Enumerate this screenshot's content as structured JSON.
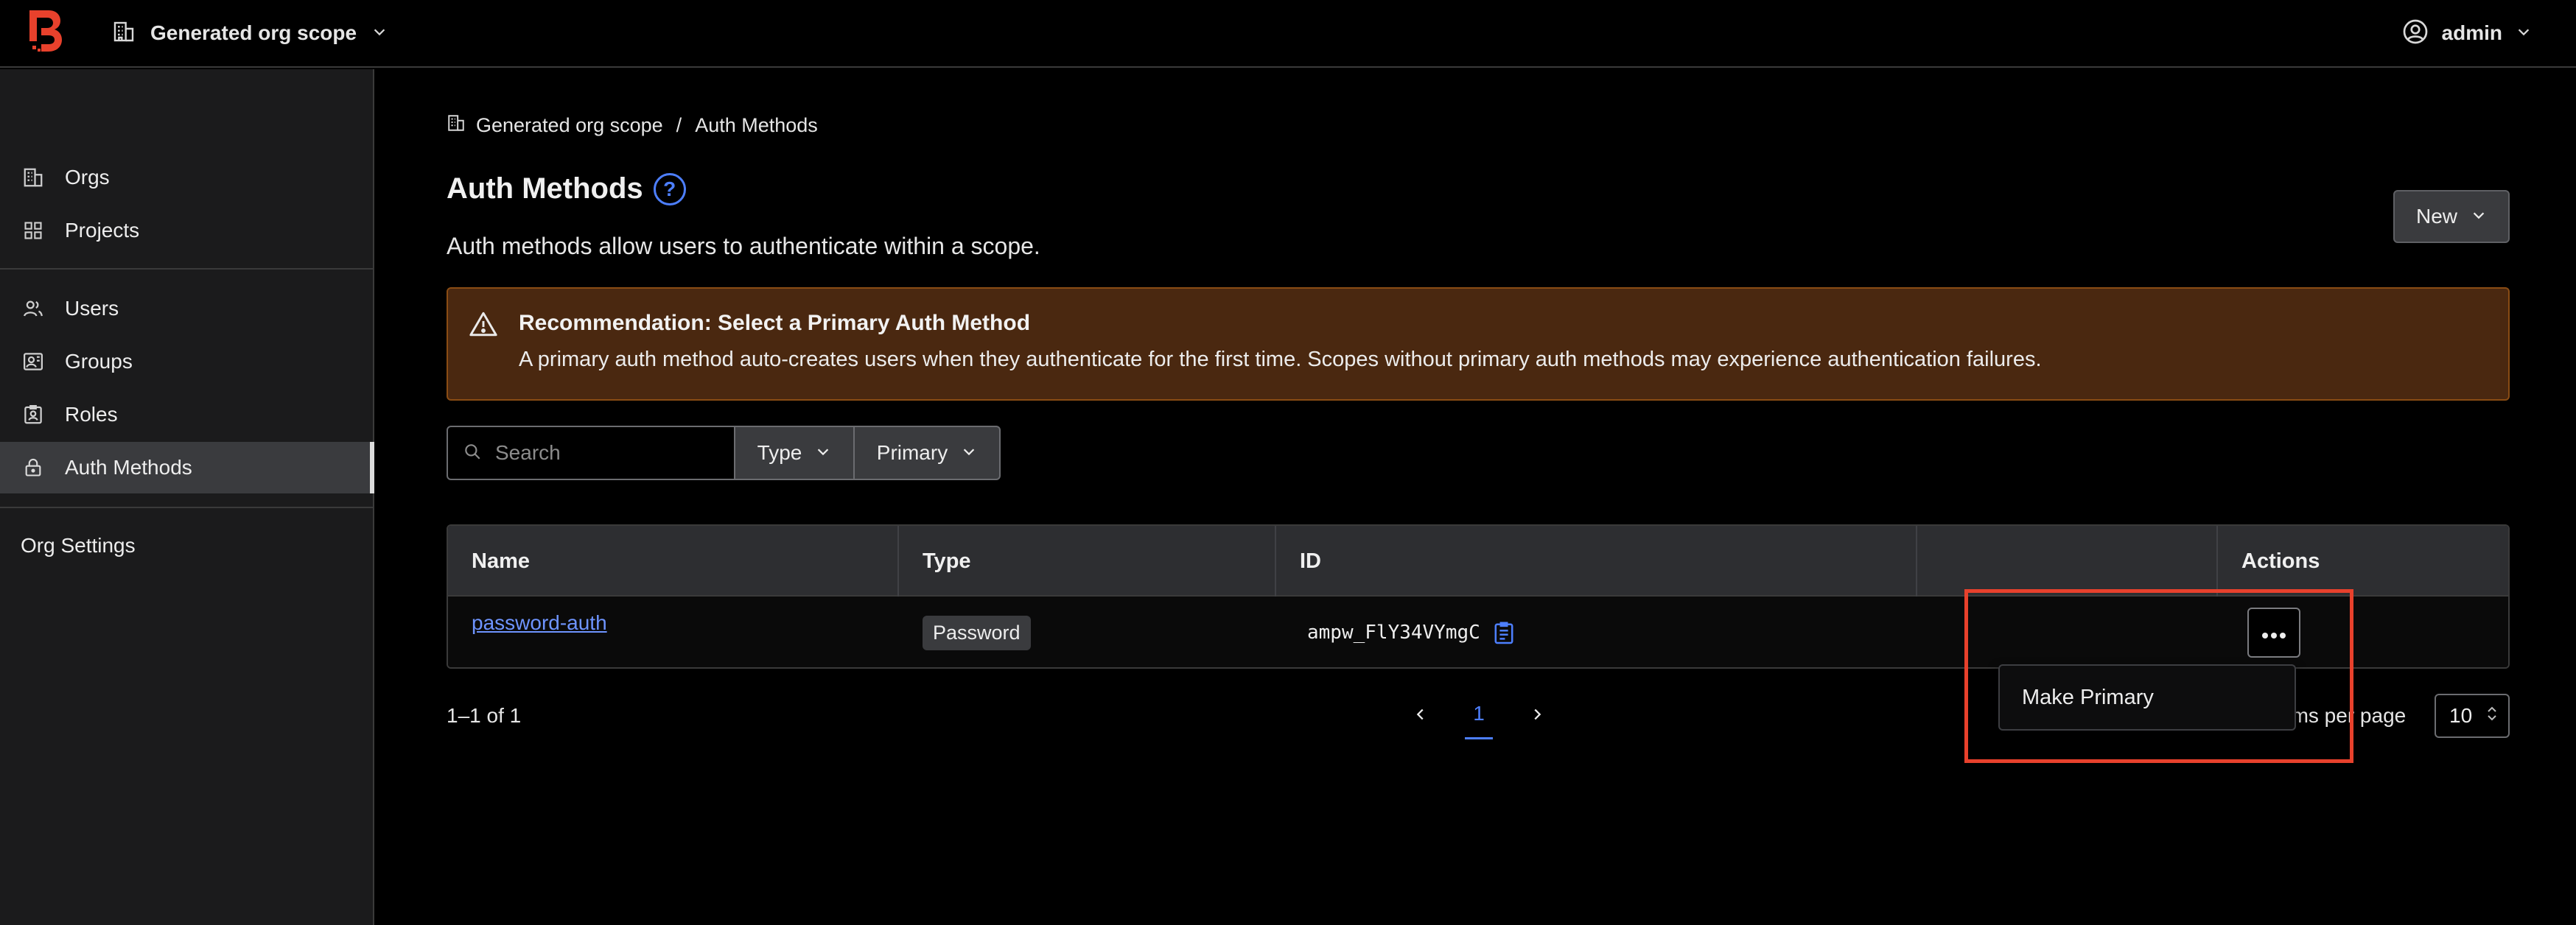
{
  "header": {
    "scope_label": "Generated org scope",
    "user_label": "admin"
  },
  "sidebar": {
    "items": [
      {
        "label": "Orgs",
        "icon": "building-icon"
      },
      {
        "label": "Projects",
        "icon": "grid-icon"
      },
      {
        "label": "Users",
        "icon": "users-icon"
      },
      {
        "label": "Groups",
        "icon": "groups-icon"
      },
      {
        "label": "Roles",
        "icon": "roles-icon"
      },
      {
        "label": "Auth Methods",
        "icon": "lock-icon",
        "active": true
      },
      {
        "label": "Org Settings"
      }
    ]
  },
  "breadcrumb": {
    "scope": "Generated org scope",
    "separator": "/",
    "current": "Auth Methods"
  },
  "page": {
    "title": "Auth Methods",
    "help_glyph": "?",
    "subtitle": "Auth methods allow users to authenticate within a scope.",
    "new_label": "New"
  },
  "alert": {
    "title": "Recommendation: Select a Primary Auth Method",
    "description": "A primary auth method auto-creates users when they authenticate for the first time. Scopes without primary auth methods may experience authentication failures."
  },
  "filters": {
    "search_placeholder": "Search",
    "type_label": "Type",
    "primary_label": "Primary"
  },
  "table": {
    "columns": [
      "Name",
      "Type",
      "ID",
      "",
      "Actions"
    ],
    "rows": [
      {
        "name": "password-auth",
        "type": "Password",
        "id": "ampw_FlY34VYmgC"
      }
    ]
  },
  "dropdown": {
    "items": [
      "Make Primary"
    ]
  },
  "pagination": {
    "range": "1–1 of 1",
    "current_page": "1",
    "per_page_label": "ems per page",
    "per_page_value": "10"
  },
  "colors": {
    "accent": "#4d7fff",
    "warning_bg": "#4a2810",
    "highlight": "#e8412c",
    "logo": "#e8412c"
  }
}
